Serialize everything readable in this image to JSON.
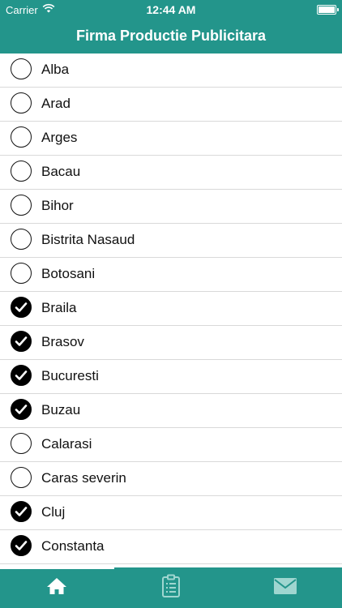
{
  "status_bar": {
    "carrier": "Carrier",
    "time": "12:44 AM",
    "icons": [
      "wifi-icon",
      "battery-icon"
    ]
  },
  "nav": {
    "title": "Firma Productie Publicitara"
  },
  "list": {
    "items": [
      {
        "label": "Alba",
        "checked": false
      },
      {
        "label": "Arad",
        "checked": false
      },
      {
        "label": "Arges",
        "checked": false
      },
      {
        "label": "Bacau",
        "checked": false
      },
      {
        "label": "Bihor",
        "checked": false
      },
      {
        "label": "Bistrita Nasaud",
        "checked": false
      },
      {
        "label": "Botosani",
        "checked": false
      },
      {
        "label": "Braila",
        "checked": true
      },
      {
        "label": "Brasov",
        "checked": true
      },
      {
        "label": "Bucuresti",
        "checked": true
      },
      {
        "label": "Buzau",
        "checked": true
      },
      {
        "label": "Calarasi",
        "checked": false
      },
      {
        "label": "Caras severin",
        "checked": false
      },
      {
        "label": "Cluj",
        "checked": true
      },
      {
        "label": "Constanta",
        "checked": true
      }
    ]
  },
  "tab_bar": {
    "tabs": [
      {
        "icon": "home-icon",
        "active": true
      },
      {
        "icon": "clipboard-icon",
        "active": false
      },
      {
        "icon": "mail-icon",
        "active": false
      }
    ]
  },
  "colors": {
    "accent": "#23958b",
    "active_icon": "#ffffff",
    "inactive_icon": "#9fd6d0"
  }
}
